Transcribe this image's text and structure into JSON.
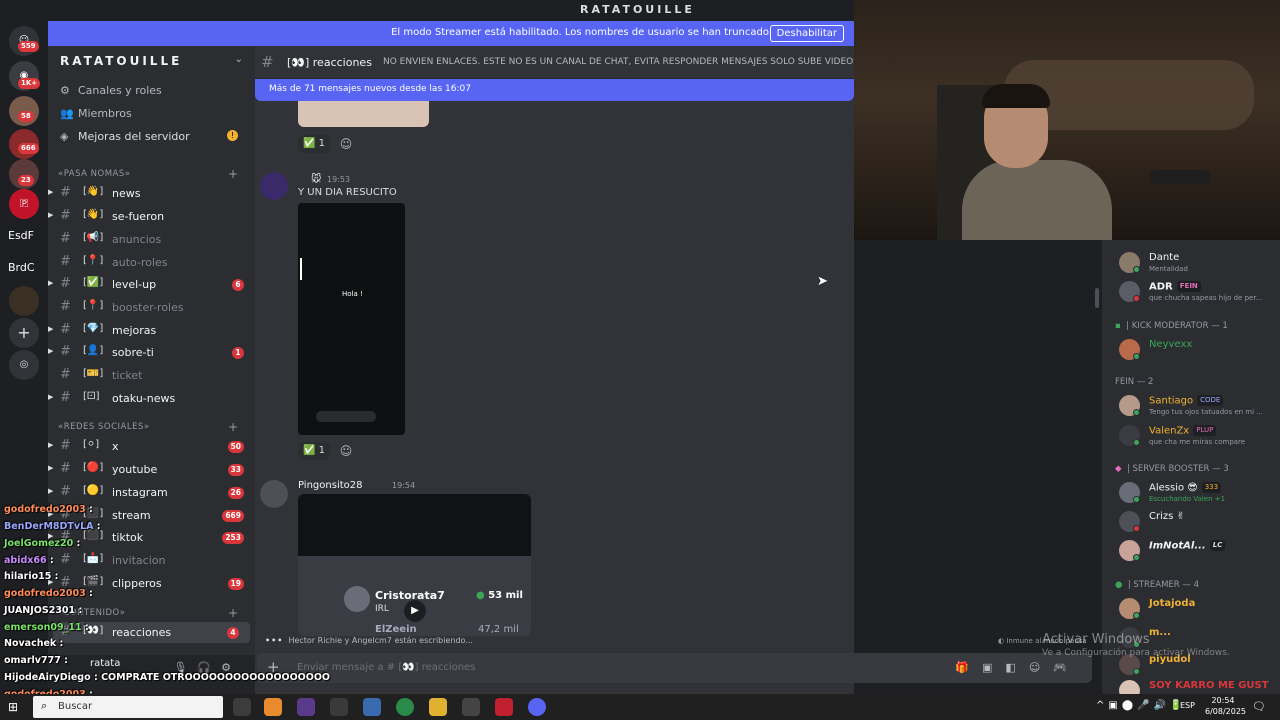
{
  "window_title": "RATATOUILLE",
  "banner": {
    "text": "El modo Streamer está habilitado. Los nombres de usuario se han truncado.",
    "button": "Deshabilitar"
  },
  "rail": {
    "badges": [
      "559",
      "1K+",
      "58",
      "666",
      "23"
    ],
    "labels": [
      "EsdF",
      "BrdC"
    ]
  },
  "server": {
    "name": "RATATOUILLE",
    "nav": [
      "Canales y roles",
      "Miembros",
      "Mejoras del servidor"
    ],
    "categories": [
      "«PASA NOMAS»",
      "«REDES SOCIALES»",
      "«CONTENIDO»"
    ],
    "channels": [
      {
        "name": "news",
        "emoji": "[👋]",
        "badge": ""
      },
      {
        "name": "se-fueron",
        "emoji": "[👋]",
        "badge": ""
      },
      {
        "name": "anuncios",
        "emoji": "[📢]",
        "badge": ""
      },
      {
        "name": "auto-roles",
        "emoji": "[📍]",
        "badge": ""
      },
      {
        "name": "level-up",
        "emoji": "[✅]",
        "badge": "6"
      },
      {
        "name": "booster-roles",
        "emoji": "[📍]",
        "badge": ""
      },
      {
        "name": "mejoras",
        "emoji": "[💎]",
        "badge": ""
      },
      {
        "name": "sobre-ti",
        "emoji": "[👤]",
        "badge": "1"
      },
      {
        "name": "ticket",
        "emoji": "[🎫]",
        "badge": ""
      },
      {
        "name": "otaku-news",
        "emoji": "[⚀]",
        "badge": ""
      },
      {
        "name": "x",
        "emoji": "[⚪]",
        "badge": "50"
      },
      {
        "name": "youtube",
        "emoji": "[🔴]",
        "badge": "33"
      },
      {
        "name": "instagram",
        "emoji": "[🟡]",
        "badge": "26"
      },
      {
        "name": "stream",
        "emoji": "[⬛]",
        "badge": "669"
      },
      {
        "name": "tiktok",
        "emoji": "[⬛]",
        "badge": "253"
      },
      {
        "name": "invitacion",
        "emoji": "[📩]",
        "badge": ""
      },
      {
        "name": "clipperos",
        "emoji": "[🎬]",
        "badge": "19"
      },
      {
        "name": "reacciones",
        "emoji": "[👀]",
        "badge": "4"
      }
    ]
  },
  "chat": {
    "channel": "reacciones",
    "topic": "NO ENVIEN ENLACES. ESTE NO ES UN CANAL DE CHAT, EVITA RESPONDER MENSAJES SOLO SUBE VIDEOS",
    "new_messages": "Más de 71 mensajes nuevos desde las 16:07",
    "msg1": {
      "reaction_count": "1"
    },
    "msg2": {
      "time": "19:53",
      "text": "Y UN DIA RESUCITO",
      "phone_text": "Hola !",
      "reaction_count": "1"
    },
    "msg3": {
      "author": "Pingonsito28",
      "time": "19:54",
      "card_name": "Cristorata7",
      "card_sub": "IRL",
      "card_views": "53 mil",
      "card_name2": "ElZeein",
      "card_views2": "47,2 mil"
    },
    "typing": "Hector Richie y Angelcm7 están escribiendo...",
    "composer_placeholder": "Enviar mensaje a #  [👀]  reacciones"
  },
  "members": {
    "items": [
      {
        "name": "Dante",
        "sub": "Mentalidad",
        "color": "#f2f3f5"
      },
      {
        "name": "ADR",
        "sub": "que chucha sapeas hijo de per...",
        "tag": "FEIN",
        "color": "#f2f3f5"
      }
    ],
    "sections": [
      "KICK MODERATOR — 1",
      "FEIN — 2",
      "SERVER BOOSTER — 3",
      "STREAMER — 4"
    ],
    "kick": [
      {
        "name": "Neyvexx",
        "color": "#3ba55c"
      }
    ],
    "fein": [
      {
        "name": "Santiago",
        "sub": "Tengo tus ojos tatuados en mi ...",
        "tag": "CODE",
        "color": "#f0b232"
      },
      {
        "name": "ValenZx",
        "sub": "que cha me miras compare",
        "tag": "PLUP",
        "color": "#f0b232"
      }
    ],
    "booster": [
      {
        "name": "Alessio",
        "sub": "Escuchando Valen +1",
        "tag": "333",
        "color": "#f2f3f5"
      },
      {
        "name": "Crizs",
        "sub": "",
        "color": "#f2f3f5"
      },
      {
        "name": "ImNotAl...",
        "sub": "",
        "tag": "LC",
        "color": "#f2f3f5"
      }
    ],
    "streamer": [
      {
        "name": "Jotajoda",
        "color": "#f0b232"
      },
      {
        "name": "m...",
        "color": "#f0b232"
      },
      {
        "name": "piyudol",
        "color": "#f0b232"
      },
      {
        "name": "SOY KARRO ME GUST",
        "color": "#da373c"
      }
    ],
    "immune_text": "Inmune al modo pausa"
  },
  "twitch_chat": [
    {
      "user": "godofredo2003",
      "msg": "",
      "color": "#ff8c5a"
    },
    {
      "user": "BenDerM8DTvLA",
      "msg": "",
      "color": "#9aa8ff"
    },
    {
      "user": "JoelGomez20",
      "msg": "",
      "color": "#79e36b"
    },
    {
      "user": "abidx66",
      "msg": "",
      "color": "#c98bff"
    },
    {
      "user": "hilario15",
      "msg": "",
      "color": "#ffffff"
    },
    {
      "user": "godofredo2003",
      "msg": "",
      "color": "#ff8c5a"
    },
    {
      "user": "JUANJOS2301",
      "msg": "",
      "color": "#ffffff"
    },
    {
      "user": "emerson09_11",
      "msg": "",
      "color": "#79e36b"
    },
    {
      "user": "Novachek",
      "msg": "",
      "color": "#ffffff"
    },
    {
      "user": "omarlv777",
      "msg": "",
      "color": "#ffffff"
    },
    {
      "user": "HijodeAiryDiego",
      "msg": "COMPRATE OTROOOOOOOOOOOOOOOOOO",
      "color": "#ffffff"
    },
    {
      "user": "godofredo2003",
      "msg": "",
      "color": "#ff8c5a"
    }
  ],
  "user_panel": {
    "name": "ratata"
  },
  "activate": {
    "title": "Activar Windows",
    "sub": "Ve a Configuración para activar Windows."
  },
  "taskbar": {
    "search": "Buscar",
    "lang": "ESP",
    "time": "20:54",
    "date": "6/08/2025"
  }
}
